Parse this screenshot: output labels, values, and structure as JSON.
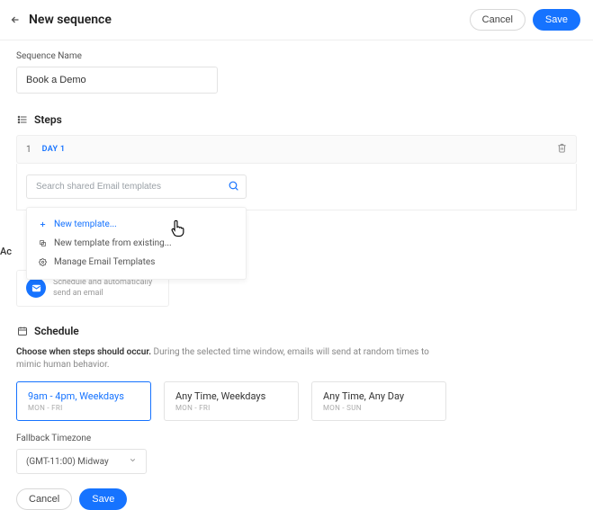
{
  "header": {
    "title": "New sequence",
    "cancel": "Cancel",
    "save": "Save"
  },
  "sequence": {
    "name_label": "Sequence Name",
    "name_value": "Book a Demo"
  },
  "steps": {
    "heading": "Steps",
    "step_number": "1",
    "day_label": "DAY 1",
    "search_placeholder": "Search shared Email templates",
    "menu": {
      "new_template": "New template...",
      "from_existing": "New template from existing...",
      "manage": "Manage Email Templates"
    }
  },
  "actions": {
    "label_truncated": "Ac",
    "mail_desc": "Schedule and automatically send an email"
  },
  "schedule": {
    "heading": "Schedule",
    "desc_bold": "Choose when steps should occur.",
    "desc_rest": " During the selected time window, emails will send at random times to mimic human behavior.",
    "options": [
      {
        "title": "9am - 4pm, Weekdays",
        "sub": "MON - FRI"
      },
      {
        "title": "Any Time, Weekdays",
        "sub": "MON - FRI"
      },
      {
        "title": "Any Time, Any Day",
        "sub": "MON - SUN"
      }
    ],
    "tz_label": "Fallback Timezone",
    "tz_value": "(GMT-11:00) Midway"
  },
  "footer": {
    "cancel": "Cancel",
    "save": "Save"
  }
}
